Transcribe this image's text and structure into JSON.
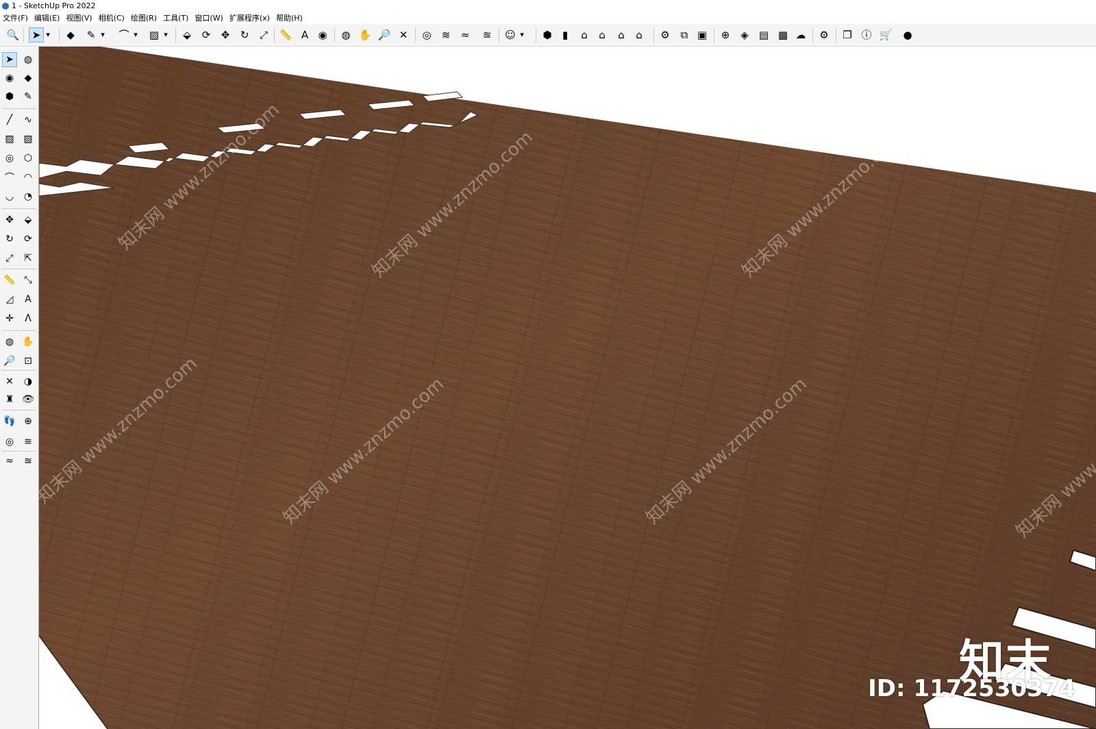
{
  "window": {
    "title": "1 - SketchUp Pro 2022"
  },
  "menu": [
    "文件(F)",
    "编辑(E)",
    "视图(V)",
    "相机(C)",
    "绘图(R)",
    "工具(T)",
    "窗口(W)",
    "扩展程序(x)",
    "帮助(H)"
  ],
  "top_toolbar": [
    {
      "name": "zoom",
      "glyph": "🔍"
    },
    {
      "name": "select",
      "glyph": "➤"
    },
    {
      "name": "select-dropdown",
      "glyph": "▾"
    },
    {
      "name": "eraser",
      "glyph": "◆"
    },
    {
      "name": "line",
      "glyph": "✎"
    },
    {
      "name": "line-dropdown",
      "glyph": "▾"
    },
    {
      "name": "arc",
      "glyph": "⌒"
    },
    {
      "name": "arc-dropdown",
      "glyph": "▾"
    },
    {
      "name": "rectangle",
      "glyph": "▨"
    },
    {
      "name": "rectangle-dropdown",
      "glyph": "▾"
    },
    {
      "name": "push-pull",
      "glyph": "⬙"
    },
    {
      "name": "follow-me",
      "glyph": "⟳"
    },
    {
      "name": "move",
      "glyph": "✥"
    },
    {
      "name": "rotate",
      "glyph": "↻"
    },
    {
      "name": "scale",
      "glyph": "⤢"
    },
    {
      "name": "tape-measure",
      "glyph": "📏"
    },
    {
      "name": "text",
      "glyph": "A"
    },
    {
      "name": "paint-bucket",
      "glyph": "◉"
    },
    {
      "name": "orbit",
      "glyph": "◍"
    },
    {
      "name": "pan",
      "glyph": "✋"
    },
    {
      "name": "zoom-tool",
      "glyph": "🔎"
    },
    {
      "name": "zoom-extents",
      "glyph": "✕"
    },
    {
      "name": "sandbox-from-contours",
      "glyph": "◎"
    },
    {
      "name": "sandbox-from-scratch",
      "glyph": "≋"
    },
    {
      "name": "sandbox-smoove",
      "glyph": "≈"
    },
    {
      "name": "sandbox-stamp",
      "glyph": "≊"
    },
    {
      "name": "user",
      "glyph": "☺"
    },
    {
      "name": "user-dropdown",
      "glyph": "▾"
    },
    {
      "name": "view-iso",
      "glyph": "⬢"
    },
    {
      "name": "view-right",
      "glyph": "▮"
    },
    {
      "name": "view-front",
      "glyph": "⌂"
    },
    {
      "name": "view-top",
      "glyph": "⌂"
    },
    {
      "name": "view-back",
      "glyph": "⌂"
    },
    {
      "name": "view-left",
      "glyph": "⌂"
    },
    {
      "name": "model-info",
      "glyph": "⚙"
    },
    {
      "name": "components",
      "glyph": "⧉"
    },
    {
      "name": "layers",
      "glyph": "▣"
    },
    {
      "name": "add-location",
      "glyph": "⊕"
    },
    {
      "name": "shadows",
      "glyph": "◈"
    },
    {
      "name": "styles",
      "glyph": "▤"
    },
    {
      "name": "fog",
      "glyph": "▩"
    },
    {
      "name": "cloud-upload",
      "glyph": "☁"
    },
    {
      "name": "extension-manager",
      "glyph": "⚙"
    },
    {
      "name": "scenes",
      "glyph": "❐"
    },
    {
      "name": "instructor",
      "glyph": "ⓘ"
    },
    {
      "name": "extension-warehouse",
      "glyph": "🛒"
    },
    {
      "name": "account",
      "glyph": "●"
    }
  ],
  "left_toolbar": [
    {
      "name": "select",
      "glyph": "➤"
    },
    {
      "name": "orbit",
      "glyph": "◍"
    },
    {
      "name": "paint-bucket",
      "glyph": "◉"
    },
    {
      "name": "eraser",
      "glyph": "◆"
    },
    {
      "name": "make-component",
      "glyph": "⬢"
    },
    {
      "name": "tag",
      "glyph": "✎"
    },
    {
      "name": "line",
      "glyph": "╱"
    },
    {
      "name": "freehand",
      "glyph": "∿"
    },
    {
      "name": "rectangle",
      "glyph": "▨"
    },
    {
      "name": "rotated-rectangle",
      "glyph": "▧"
    },
    {
      "name": "circle",
      "glyph": "◎"
    },
    {
      "name": "polygon",
      "glyph": "⬡"
    },
    {
      "name": "arc",
      "glyph": "⌒"
    },
    {
      "name": "two-point-arc",
      "glyph": "◠"
    },
    {
      "name": "three-point-arc",
      "glyph": "◡"
    },
    {
      "name": "pie",
      "glyph": "◔"
    },
    {
      "name": "move",
      "glyph": "✥"
    },
    {
      "name": "push-pull",
      "glyph": "⬙"
    },
    {
      "name": "rotate",
      "glyph": "↻"
    },
    {
      "name": "follow-me",
      "glyph": "⟳"
    },
    {
      "name": "scale",
      "glyph": "⤢"
    },
    {
      "name": "offset",
      "glyph": "⇱"
    },
    {
      "name": "tape-measure",
      "glyph": "📏"
    },
    {
      "name": "dimension",
      "glyph": "⤡"
    },
    {
      "name": "protractor",
      "glyph": "◿"
    },
    {
      "name": "text",
      "glyph": "A"
    },
    {
      "name": "axes",
      "glyph": "✛"
    },
    {
      "name": "3d-text",
      "glyph": "Ʌ"
    },
    {
      "name": "orbit-2",
      "glyph": "◍"
    },
    {
      "name": "pan",
      "glyph": "✋"
    },
    {
      "name": "zoom",
      "glyph": "🔎"
    },
    {
      "name": "zoom-window",
      "glyph": "⊡"
    },
    {
      "name": "zoom-extents",
      "glyph": "✕"
    },
    {
      "name": "previous",
      "glyph": "◑"
    },
    {
      "name": "position-camera",
      "glyph": "♜"
    },
    {
      "name": "look-around",
      "glyph": "👁"
    },
    {
      "name": "walk",
      "glyph": "👣"
    },
    {
      "name": "section-plane",
      "glyph": "⊕"
    },
    {
      "name": "sandbox-from-contours",
      "glyph": "◎"
    },
    {
      "name": "sandbox-from-scratch",
      "glyph": "≋"
    },
    {
      "name": "sandbox-smoove",
      "glyph": "≈"
    },
    {
      "name": "sandbox-stamp",
      "glyph": "≊"
    }
  ],
  "watermarks": [
    "知末网 www.znzmo.com",
    "知末网 www.znzmo.com",
    "知末网 www.znzmo.com",
    "知末网 www.znzmo.com",
    "知末网 www.znzmo.com",
    "知末网 www.znzmo.com",
    "知末网 www.znzmo.com"
  ],
  "brand": {
    "name": "知末",
    "id_text": "ID: 1172530374"
  },
  "colors": {
    "wood": "#6a4731",
    "wood_dark": "#4f3423",
    "wood_light": "#83593c",
    "toolbar_bg": "#f4f4f4",
    "active_bg": "#cde3f7"
  }
}
